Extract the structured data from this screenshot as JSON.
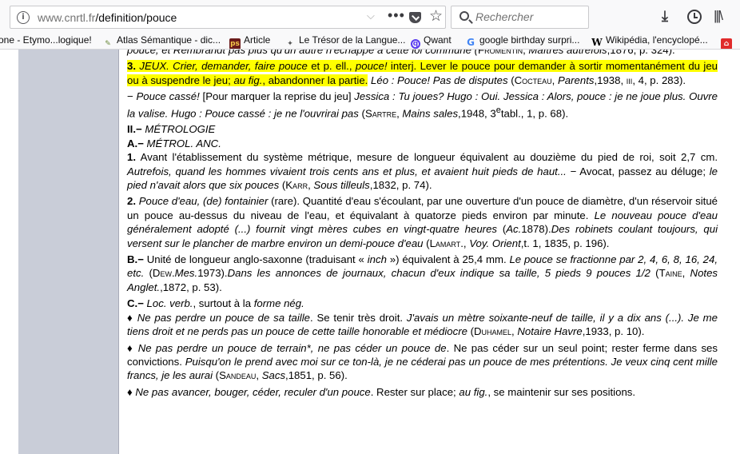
{
  "browser": {
    "url_host": "www.cnrtl.fr",
    "url_path": "/definition/pouce",
    "search_placeholder": "Rechercher"
  },
  "bookmarks": [
    "one - Etymo...logique!",
    "Atlas Sémantique - dic...",
    "Article",
    "Le Trésor de la Langue...",
    "Qwant",
    "google birthday surpri...",
    "Wikipédia, l'encyclopé..."
  ],
  "icons": {
    "toolbar": [
      "info-icon",
      "chevron-down-icon",
      "more-icon",
      "pocket-icon",
      "star-icon",
      "search-icon",
      "download-icon",
      "history-icon",
      "library-icon"
    ],
    "highlight_color": "#ffff00",
    "sidebar_color": "#c9cdd8"
  },
  "entry": {
    "p0": {
      "t1": "pouce, et Rembrandt pas plus qu'un autre n'échappe à cette loi commune (",
      "s1": "Fromentin",
      "t2": ", ",
      "i1": "Maîtres autrefois",
      "t3": ",1876, p. 324)."
    },
    "p1": {
      "num": "3.",
      "i1": " JEUX. Crier, demander, faire pouce ",
      "t1": "et p. ell., ",
      "i2": "pouce!",
      "t2": " interj. Lever le pouce pour demander à sortir momentanément du jeu ou à suspendre le jeu; ",
      "i3": "au fig.",
      "t3": ", abandonner la partie.",
      "i4": " Léo : Pouce! Pas de disputes",
      "t4": " (",
      "s1": "Cocteau",
      "t5": ", ",
      "i5": "Parents",
      "t6": ",1938, ",
      "s2": "iii",
      "t7": ", 4, p. 283)."
    },
    "p2": {
      "t1": "− ",
      "i1": "Pouce cassé!",
      "t2": " [Pour marquer la reprise du jeu] ",
      "i2": "Jessica : Tu joues? Hugo : Oui. Jessica : Alors, pouce : je ne joue plus. Ouvre la valise. Hugo : Pouce cassé : je ne l'ouvrirai pas",
      "t3": " (",
      "s1": "Sartre",
      "t4": ", ",
      "i3": "Mains sales",
      "t5": ",1948, 3",
      "sup": "e",
      "t6": "tabl., 1, p. 68)."
    },
    "h1": {
      "num": "II.−",
      "label": " MÉTROLOGIE"
    },
    "h2": {
      "num": "A.−",
      "label": " MÉTROL. ANC."
    },
    "p3": {
      "num": "1.",
      "t1": " Avant l'établissement du système métrique, mesure de longueur équivalent au douzième du pied de roi, soit 2,7 cm. ",
      "i1": "Autrefois, quand les hommes vivaient trois cents ans et plus, et avaient huit pieds de haut...",
      "t2": " − Avocat, passez au déluge; ",
      "i2": "le pied n'avait alors que six pouces",
      "t3": " (",
      "s1": "Karr",
      "t4": ", ",
      "i3": "Sous tilleuls",
      "t5": ",1832, p. 74)."
    },
    "p4": {
      "num": "2.",
      "i1": " Pouce d'eau, (de) fontainier",
      "t1": " (rare). Quantité d'eau s'écoulant, par une ouverture d'un pouce de diamètre, d'un réservoir situé un pouce au-dessus du niveau de l'eau, et équivalant à quatorze pieds environ par minute. ",
      "i2": "Le nouveau pouce d'eau généralement adopté (...) fournit vingt mères cubes en vingt-quatre heures",
      "t2": " (",
      "i3": "Ac.",
      "t3": "1878).",
      "i4": "Des robinets coulant toujours, qui versent sur le plancher de marbre environ un demi-pouce d'eau",
      "t4": " (",
      "s1": "Lamart.",
      "t5": ", ",
      "i5": "Voy. Orient",
      "t6": ",t. 1, 1835, p. 196)."
    },
    "p5": {
      "num": "B.−",
      "t1": " Unité de longueur anglo-saxonne (traduisant « ",
      "i1": "inch",
      "t2": " ») équivalent à 25,4 mm. ",
      "i2": "Le pouce se fractionne par 2, 4, 6, 8, 16, 24, etc.",
      "t3": " (",
      "s1": "Dew.",
      "i3": "Mes.",
      "t4": "1973).",
      "i4": "Dans les annonces de journaux, chacun d'eux indique sa taille, 5 pieds 9 pouces 1/2",
      "t5": " (",
      "s2": "Taine",
      "t6": ", ",
      "i5": "Notes Anglet.",
      "t7": ",1872, p. 53)."
    },
    "p6": {
      "num": "C.−",
      "i1": " Loc. verb.",
      "t1": ", surtout à la ",
      "i2": "forme nég.",
      "t2": "",
      "t3": "♦ ",
      "i3": "Ne pas perdre un pouce de sa taille",
      "t4": ". Se tenir très droit. ",
      "i4": "J'avais un mètre soixante-neuf de taille, il y a dix ans (...). Je me tiens droit et ne perds pas un pouce de cette taille honorable et médiocre",
      "t5": " (",
      "s1": "Duhamel",
      "t6": ", ",
      "i5": "Notaire Havre",
      "t7": ",1933, p. 10)."
    },
    "p7": {
      "t1": "♦ ",
      "i1": "Ne pas perdre un pouce de terrain*, ne pas céder un pouce de",
      "t2": ". Ne pas céder sur un seul point; rester ferme dans ses convictions. ",
      "i2": "Puisqu'on le prend avec moi sur ce ton-là, je ne céderai pas un pouce de mes prétentions. Je veux cinq cent mille francs, je les aurai",
      "t3": " (",
      "s1": "Sandeau",
      "t4": ", ",
      "i3": "Sacs",
      "t5": ",1851, p. 56)."
    },
    "p8": {
      "t1": "♦ ",
      "i1": "Ne pas avancer, bouger, céder, reculer d'un pouce",
      "t2": ". Rester sur place; ",
      "i2": "au fig.",
      "t3": ", se maintenir sur ses positions."
    }
  }
}
